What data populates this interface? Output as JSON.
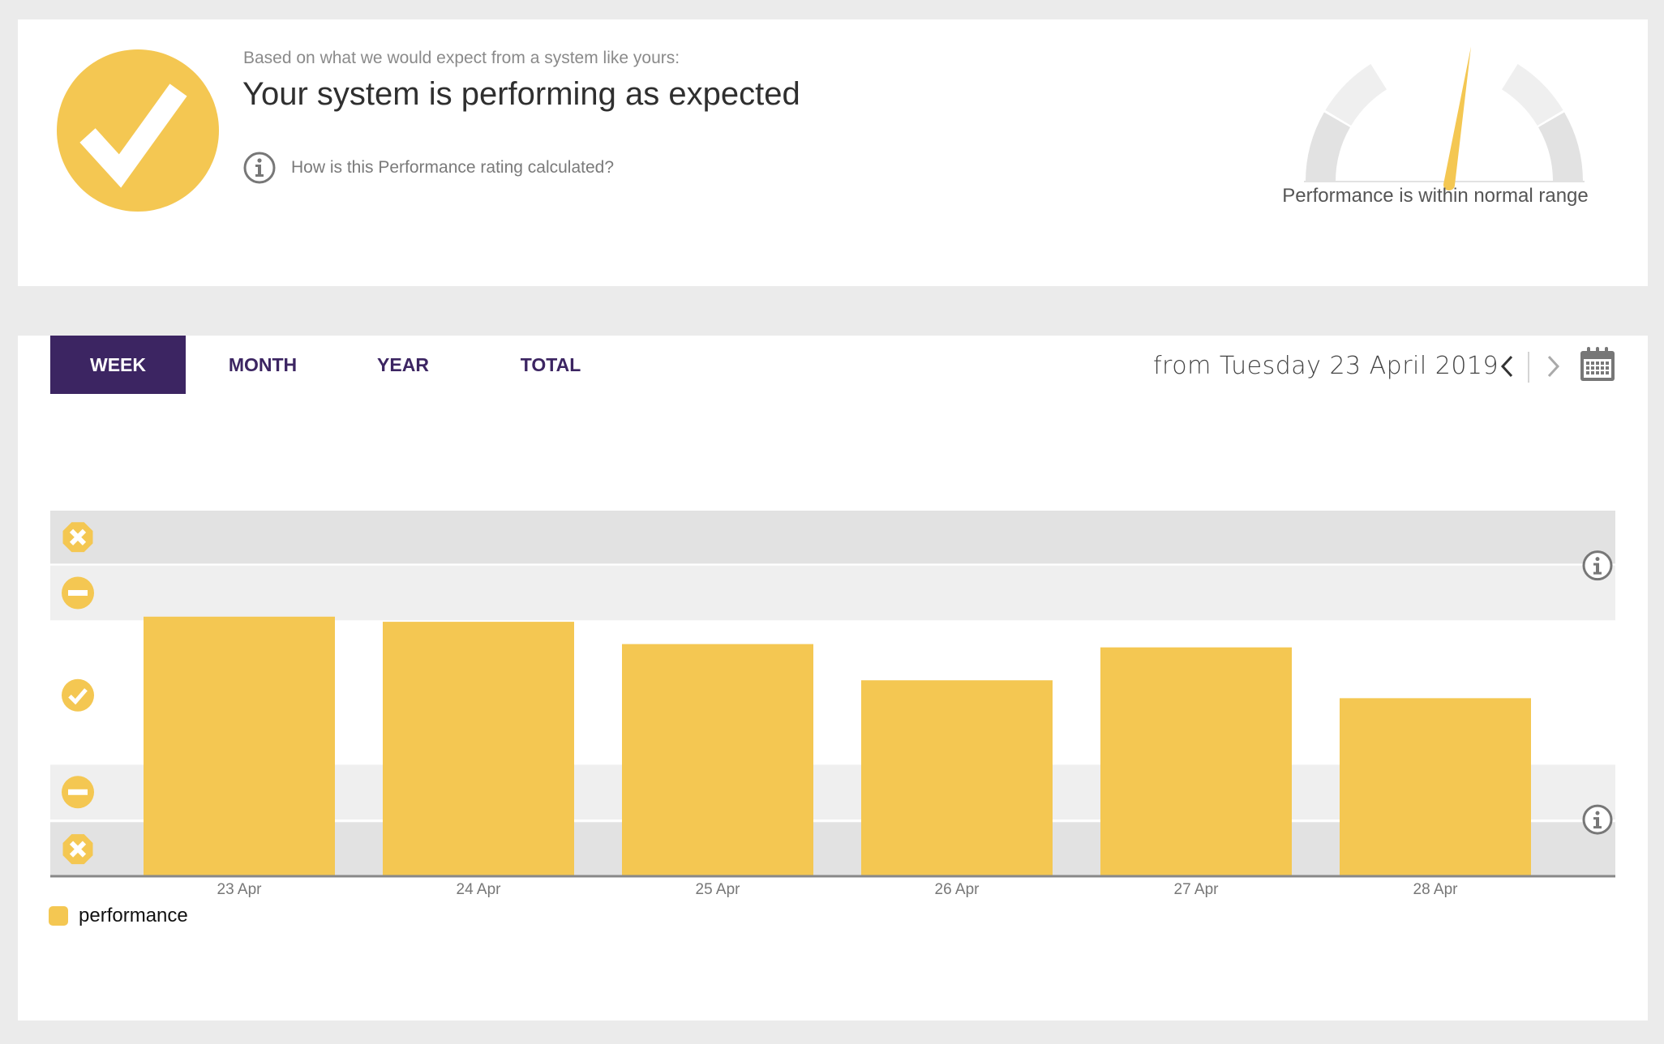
{
  "colors": {
    "accent": "#f4c752",
    "brand": "#3c2562",
    "band_critical": "#e2e2e2",
    "band_warning": "#efefef",
    "axis": "#888888",
    "icon_gray": "#777777"
  },
  "status": {
    "icon": "check-circle-icon",
    "subtitle": "Based on what we would expect from a system like yours:",
    "headline": "Your system is performing as expected",
    "info_icon": "info-icon",
    "info_link": "How is this Performance rating calculated?"
  },
  "gauge": {
    "label": "Performance is within normal range",
    "needle_fraction": 0.55
  },
  "tabs": [
    {
      "label": "WEEK",
      "active": true
    },
    {
      "label": "MONTH",
      "active": false
    },
    {
      "label": "YEAR",
      "active": false
    },
    {
      "label": "TOTAL",
      "active": false
    }
  ],
  "date_nav": {
    "range_text": "from Tuesday 23 April 2019",
    "prev_icon": "chevron-left-icon",
    "next_icon": "chevron-right-icon",
    "calendar_icon": "calendar-icon"
  },
  "chart_data": {
    "type": "bar",
    "title": "",
    "xlabel": "",
    "ylabel": "",
    "categories": [
      "23 Apr",
      "24 Apr",
      "25 Apr",
      "26 Apr",
      "27 Apr",
      "28 Apr"
    ],
    "series": [
      {
        "name": "performance",
        "values": [
          0.71,
          0.696,
          0.635,
          0.536,
          0.626,
          0.487
        ]
      }
    ],
    "ylim": [
      0,
      1
    ],
    "value_units": "fraction of chart height",
    "bands": [
      {
        "from": 0.855,
        "to": 1.0,
        "level": "critical-high",
        "icon": "error-icon"
      },
      {
        "from": 0.7,
        "to": 0.85,
        "level": "warning-high",
        "icon": "warning-icon"
      },
      {
        "from": 0.305,
        "to": 0.7,
        "level": "normal",
        "icon": "check-icon"
      },
      {
        "from": 0.155,
        "to": 0.305,
        "level": "warning-low",
        "icon": "warning-icon"
      },
      {
        "from": 0.0,
        "to": 0.148,
        "level": "critical-low",
        "icon": "error-icon"
      }
    ],
    "grid": false,
    "legend": {
      "position": "bottom-left",
      "entries": [
        "performance"
      ]
    }
  }
}
